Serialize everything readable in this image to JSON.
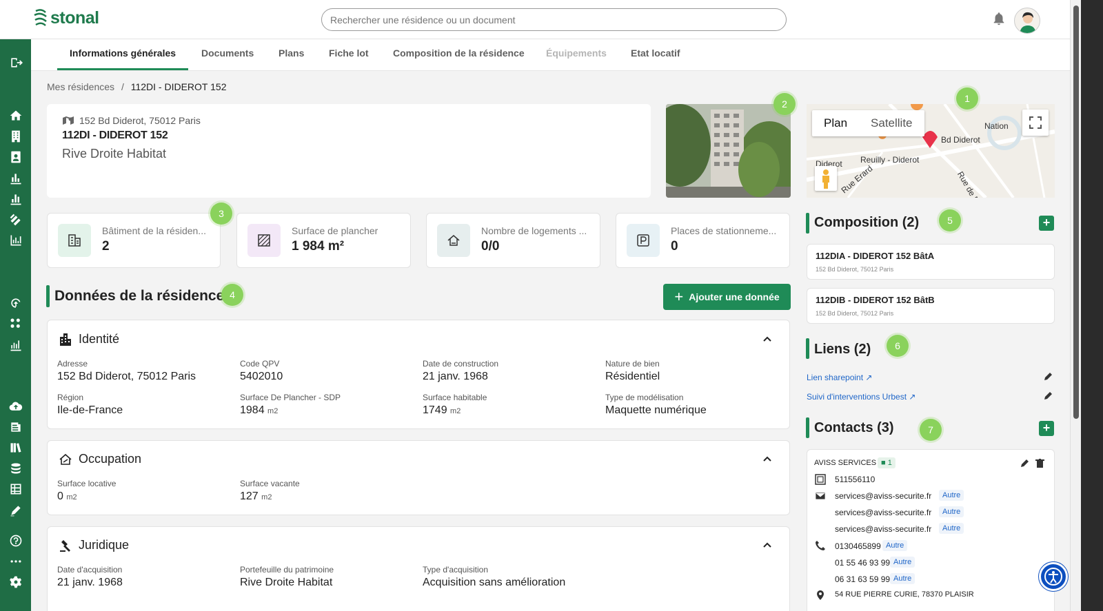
{
  "brand": {
    "name": "stonal",
    "color": "#1e7a4c"
  },
  "search": {
    "placeholder": "Rechercher une résidence ou un document"
  },
  "tabs": [
    {
      "label": "Informations générales",
      "state": "active"
    },
    {
      "label": "Documents",
      "state": "normal"
    },
    {
      "label": "Plans",
      "state": "normal"
    },
    {
      "label": "Fiche lot",
      "state": "normal"
    },
    {
      "label": "Composition de la résidence",
      "state": "normal"
    },
    {
      "label": "Équipements",
      "state": "disabled"
    },
    {
      "label": "Etat locatif",
      "state": "normal"
    }
  ],
  "breadcrumb": {
    "root": "Mes résidences",
    "separator": "/",
    "current": "112DI - DIDEROT 152"
  },
  "residence": {
    "address": "152 Bd Diderot, 75012 Paris",
    "name": "112DI - DIDEROT 152",
    "owner": "Rive Droite Habitat"
  },
  "map": {
    "plan_label": "Plan",
    "satellite_label": "Satellite",
    "labels": [
      "Bd Diderot",
      "Nation",
      "Reuilly - Diderot",
      "Rue de Picpus",
      "Rue Erard",
      "Diderot"
    ]
  },
  "stats": [
    {
      "label": "Bâtiment de la résiden...",
      "value": "2",
      "icon": "building-icon",
      "tint": "#e3f3ea"
    },
    {
      "label": "Surface de plancher",
      "value": "1 984 m²",
      "icon": "floor-icon",
      "tint": "#f3e8f7"
    },
    {
      "label": "Nombre de logements ...",
      "value": "0/0",
      "icon": "home-icon",
      "tint": "#e6eeee"
    },
    {
      "label": "Places de stationneme...",
      "value": "0",
      "icon": "parking-icon",
      "tint": "#e7f1f5"
    }
  ],
  "badges": [
    "1",
    "2",
    "3",
    "4",
    "5",
    "6",
    "7"
  ],
  "data_section": {
    "title": "Données de la résidence",
    "add_button": "Ajouter une donnée"
  },
  "identite": {
    "title": "Identité",
    "fields": [
      {
        "label": "Adresse",
        "value": "152 Bd Diderot, 75012 Paris",
        "unit": ""
      },
      {
        "label": "Code QPV",
        "value": "5402010",
        "unit": ""
      },
      {
        "label": "Date de construction",
        "value": "21 janv. 1968",
        "unit": ""
      },
      {
        "label": "Nature de bien",
        "value": "Résidentiel",
        "unit": ""
      },
      {
        "label": "Région",
        "value": "Ile-de-France",
        "unit": ""
      },
      {
        "label": "Surface De Plancher - SDP",
        "value": "1984",
        "unit": "m2"
      },
      {
        "label": "Surface habitable",
        "value": "1749",
        "unit": "m2"
      },
      {
        "label": "Type de modélisation",
        "value": "Maquette numérique",
        "unit": ""
      }
    ]
  },
  "occupation": {
    "title": "Occupation",
    "fields": [
      {
        "label": "Surface locative",
        "value": "0",
        "unit": "m2"
      },
      {
        "label": "Surface vacante",
        "value": "127",
        "unit": "m2"
      }
    ]
  },
  "juridique": {
    "title": "Juridique",
    "fields": [
      {
        "label": "Date d'acquisition",
        "value": "21 janv. 1968"
      },
      {
        "label": "Portefeuille du patrimoine",
        "value": "Rive Droite Habitat"
      },
      {
        "label": "Type d'acquisition",
        "value": "Acquisition sans amélioration"
      }
    ]
  },
  "composition": {
    "title": "Composition (2)",
    "items": [
      {
        "name": "112DIA - DIDEROT 152 BâtA",
        "address": "152 Bd Diderot, 75012 Paris"
      },
      {
        "name": "112DIB - DIDEROT 152 BâtB",
        "address": "152 Bd Diderot, 75012 Paris"
      }
    ]
  },
  "liens": {
    "title": "Liens (2)",
    "items": [
      {
        "label": "Lien sharepoint"
      },
      {
        "label": "Suivi d'interventions Urbest"
      }
    ]
  },
  "contacts": {
    "title": "Contacts (3)",
    "company": "AVISS SERVICES",
    "doc_count": "1",
    "id": "511556110",
    "emails": [
      {
        "value": "services@aviss-securite.fr",
        "tag": "Autre"
      },
      {
        "value": "services@aviss-securite.fr",
        "tag": "Autre"
      },
      {
        "value": "services@aviss-securite.fr",
        "tag": "Autre"
      }
    ],
    "phones": [
      {
        "value": "0130465899",
        "tag": "Autre"
      },
      {
        "value": "01 55 46 93 99",
        "tag": "Autre"
      },
      {
        "value": "06 31 63 59 99",
        "tag": "Autre"
      }
    ],
    "address": "54 RUE PIERRE CURIE, 78370 PLAISIR"
  },
  "colors": {
    "primary": "#1f8b57",
    "sidebar": "#1f6d45",
    "badge": "#8ad25c",
    "link": "#1f66c8"
  }
}
